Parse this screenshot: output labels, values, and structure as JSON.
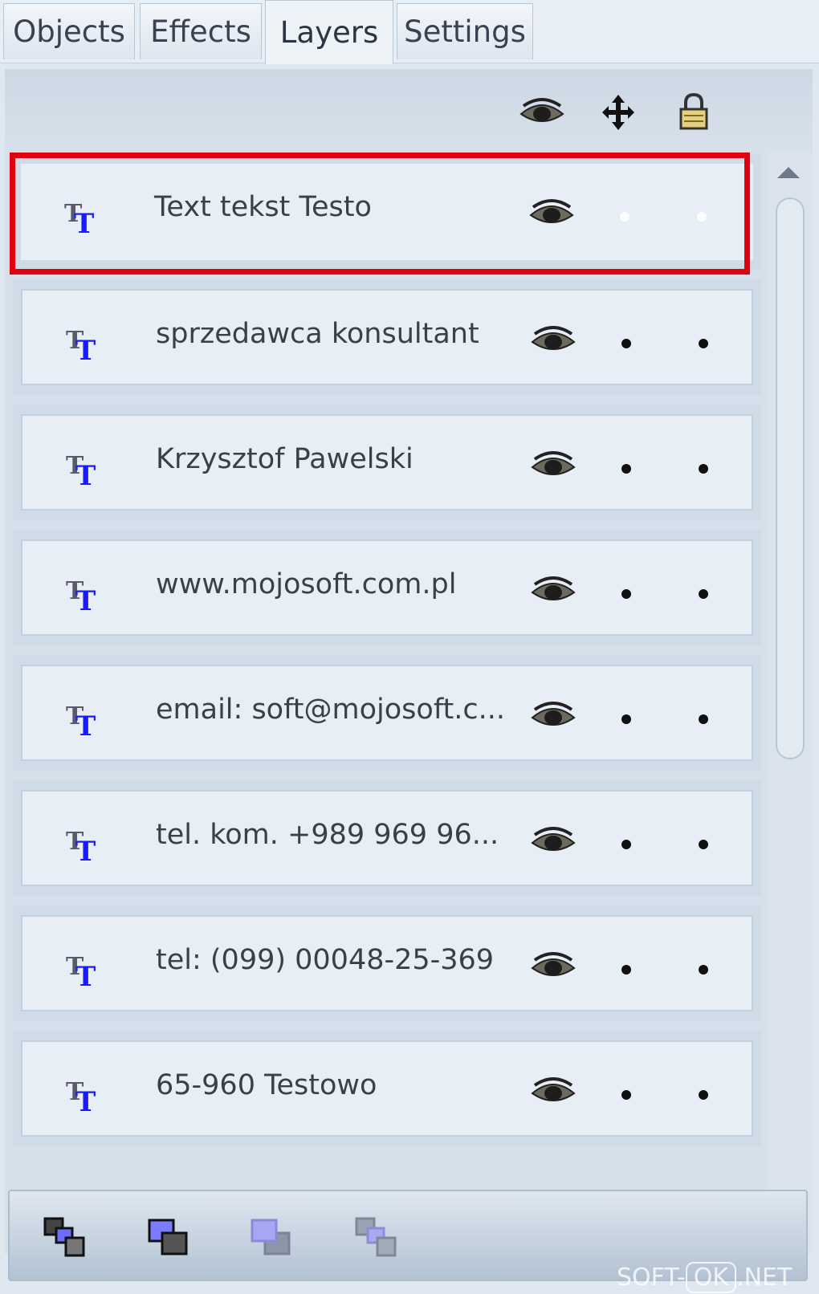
{
  "tabs": [
    {
      "label": "Objects",
      "active": false
    },
    {
      "label": "Effects",
      "active": false
    },
    {
      "label": "Layers",
      "active": true
    },
    {
      "label": "Settings",
      "active": false
    }
  ],
  "header_icons": [
    "eye-icon",
    "move-icon",
    "lock-icon"
  ],
  "layers": [
    {
      "label": "Text tekst Testo",
      "type_icon": "text-type-icon",
      "visible": true,
      "selected": true
    },
    {
      "label": "sprzedawca konsultant",
      "type_icon": "text-type-icon",
      "visible": true,
      "selected": false
    },
    {
      "label": "Krzysztof Pawelski",
      "type_icon": "text-type-icon",
      "visible": true,
      "selected": false
    },
    {
      "label": "www.mojosoft.com.pl",
      "type_icon": "text-type-icon",
      "visible": true,
      "selected": false
    },
    {
      "label": "email: soft@mojosoft.c...",
      "type_icon": "text-type-icon",
      "visible": true,
      "selected": false
    },
    {
      "label": "tel. kom. +989 969 96...",
      "type_icon": "text-type-icon",
      "visible": true,
      "selected": false
    },
    {
      "label": "tel: (099) 00048-25-369",
      "type_icon": "text-type-icon",
      "visible": true,
      "selected": false
    },
    {
      "label": "65-960 Testowo",
      "type_icon": "text-type-icon",
      "visible": true,
      "selected": false
    }
  ],
  "bottom_toolbar": [
    "bring-to-front-icon",
    "bring-forward-icon",
    "send-backward-icon",
    "send-to-back-icon"
  ],
  "watermark": {
    "left": "SOFT-",
    "box": "OK",
    "right": ".NET"
  },
  "colors": {
    "selection": "#e0000e",
    "text_icon": "#1a1aff"
  }
}
